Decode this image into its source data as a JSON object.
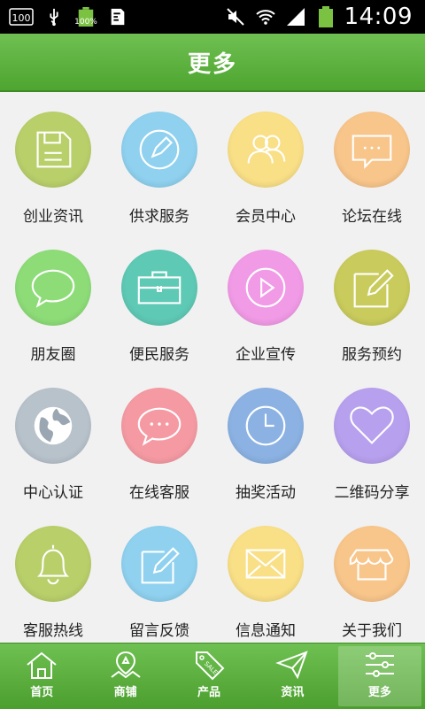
{
  "statusbar": {
    "sim_label": "100",
    "battery_label": "100%",
    "time": "14:09"
  },
  "header": {
    "title": "更多"
  },
  "grid": {
    "items": [
      {
        "label": "创业资讯",
        "icon": "floppy-disk-icon",
        "color": "#b9cf6a"
      },
      {
        "label": "供求服务",
        "icon": "pencil-circle-icon",
        "color": "#8fd1ef"
      },
      {
        "label": "会员中心",
        "icon": "users-icon",
        "color": "#f9df86"
      },
      {
        "label": "论坛在线",
        "icon": "chat-bubble-icon",
        "color": "#f8c58a"
      },
      {
        "label": "朋友圈",
        "icon": "speech-bubble-icon",
        "color": "#8ddc78"
      },
      {
        "label": "便民服务",
        "icon": "briefcase-icon",
        "color": "#5ec9b5"
      },
      {
        "label": "企业宣传",
        "icon": "play-circle-icon",
        "color": "#f19ae6"
      },
      {
        "label": "服务预约",
        "icon": "edit-note-icon",
        "color": "#c9cb5c"
      },
      {
        "label": "中心认证",
        "icon": "globe-icon",
        "color": "#b8c2cb"
      },
      {
        "label": "在线客服",
        "icon": "chat-dots-icon",
        "color": "#f59aa3"
      },
      {
        "label": "抽奖活动",
        "icon": "clock-icon",
        "color": "#8bb2e3"
      },
      {
        "label": "二维码分享",
        "icon": "heart-icon",
        "color": "#b7a0ee"
      },
      {
        "label": "客服热线",
        "icon": "bell-icon",
        "color": "#b9cf6a"
      },
      {
        "label": "留言反馈",
        "icon": "write-box-icon",
        "color": "#8fd1ef"
      },
      {
        "label": "信息通知",
        "icon": "envelope-icon",
        "color": "#f9df86"
      },
      {
        "label": "关于我们",
        "icon": "shop-icon",
        "color": "#f8c58a"
      }
    ]
  },
  "bottomnav": {
    "items": [
      {
        "label": "首页",
        "icon": "home-icon"
      },
      {
        "label": "商铺",
        "icon": "map-pin-icon"
      },
      {
        "label": "产品",
        "icon": "sale-tag-icon",
        "tag_text": "SALE"
      },
      {
        "label": "资讯",
        "icon": "paper-plane-icon"
      },
      {
        "label": "更多",
        "icon": "sliders-icon",
        "active": true
      }
    ]
  }
}
